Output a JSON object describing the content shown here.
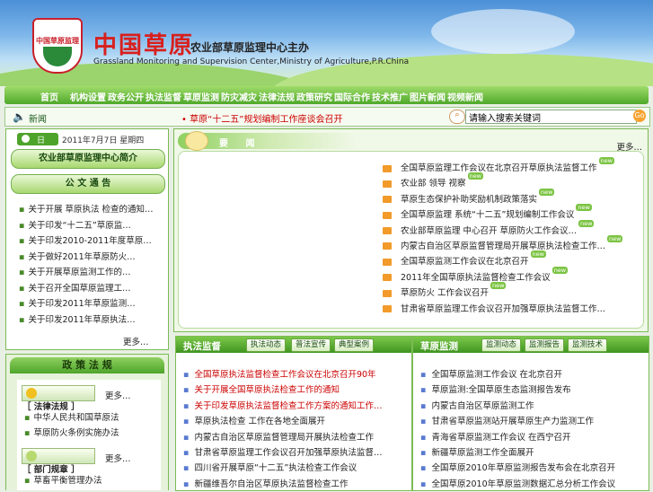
{
  "header": {
    "badge_text": "中国草原监理",
    "title": "中国草原",
    "subtitle": "农业部草原监理中心主办",
    "english": "Grassland Monitoring and Supervision Center,Ministry of Agriculture,P.R.China"
  },
  "nav": {
    "items": [
      "首页",
      "机构设置",
      "政务公开",
      "执法监督",
      "草原监测",
      "防灾减灾",
      "法律法规",
      "政策研究",
      "国际合作",
      "技术推广",
      "图片新闻",
      "视频新闻"
    ]
  },
  "newsbar": {
    "label": "新闻",
    "ticker": "• 草原“十二五”规划编制工作座谈会召开",
    "search_placeholder": "请输入搜索关键词",
    "go": "Go"
  },
  "left": {
    "date_label": "日",
    "date": "2011年7月7日 星期四",
    "intro_btn": "农业部草原监理中心简介",
    "notice_btn": "公 文 通 告",
    "notices": [
      "关于开展 草原执法 检查的通知…",
      "关于印发“十二五”草原监…",
      "关于印发2010-2011年度草原…",
      "关于做好2011年草原防火…",
      "关于开展草原监测工作的…",
      "关于召开全国草原监理工…",
      "关于印发2011年草原监测…",
      "关于印发2011年草原执法…"
    ],
    "more": "更多…"
  },
  "policy": {
    "title": "政 策 法 规",
    "law_tab": "［ 法律法规 ］",
    "laws": [
      "中华人民共和国草原法",
      "草原防火条例实施办法"
    ],
    "rule_tab": "［ 部门规章 ］",
    "rules": [
      "草畜平衡管理办法"
    ],
    "more": "更多…"
  },
  "news": {
    "title": "要 闻",
    "more": "更多…",
    "items": [
      {
        "text": "全国草原监理工作会议在北京召开草原执法监督工作",
        "new": "new"
      },
      {
        "text": "农业部 领导 视察",
        "new": "new"
      },
      {
        "text": "草原生态保护补助奖励机制政策落实",
        "new": "new"
      },
      {
        "text": "全国草原监理 系统“十二五”规划编制工作会议",
        "new": "new"
      },
      {
        "text": "农业部草原监理 中心召开 草原防火工作会议…",
        "new": "new"
      },
      {
        "text": "内蒙古自治区草原监督管理局开展草原执法检查工作…",
        "new": "new"
      },
      {
        "text": "全国草原监测工作会议在北京召开",
        "new": "new"
      },
      {
        "text": "2011年全国草原执法监督检查工作会议",
        "new": "new"
      },
      {
        "text": "草原防火 工作会议召开",
        "new": "new"
      },
      {
        "text": "甘肃省草原监理工作会议召开加强草原执法监督工作…",
        "new": ""
      }
    ]
  },
  "law_section": {
    "title": "执法监督",
    "tabs": [
      "执法动态",
      "普法宣传",
      "典型案例"
    ],
    "items": [
      {
        "text": "全国草原执法监督检查工作会议在北京召开90年",
        "red": true
      },
      {
        "text": "关于开展全国草原执法检查工作的通知",
        "red": true
      },
      {
        "text": "关于印发草原执法监督检查工作方案的通知工作…",
        "red": true
      },
      {
        "text": "草原执法检查 工作在各地全面展开",
        "red": false
      },
      {
        "text": "内蒙古自治区草原监督管理局开展执法检查工作",
        "red": false
      },
      {
        "text": "甘肃省草原监理工作会议召开加强草原执法监督…",
        "red": false
      },
      {
        "text": "四川省开展草原“十二五”执法检查工作会议",
        "red": false
      },
      {
        "text": "新疆维吾尔自治区草原执法监督检查工作",
        "red": false
      }
    ]
  },
  "monitor_section": {
    "title": "草原监测",
    "tabs": [
      "监测动态",
      "监测报告",
      "监测技术"
    ],
    "items": [
      "全国草原监测工作会议 在北京召开",
      "草原监测:全国草原生态监测报告发布",
      "内蒙古自治区草原监测工作",
      "甘肃省草原监测站开展草原生产力监测工作",
      "青海省草原监测工作会议 在西宁召开",
      "新疆草原监测工作全面展开",
      "全国草原2010年草原监测报告发布会在北京召开",
      "全国草原2010年草原监测数据汇总分析工作会议"
    ]
  },
  "colors": {
    "green": "#4ea42a",
    "red": "#d8201e",
    "orange": "#f29a2a"
  }
}
